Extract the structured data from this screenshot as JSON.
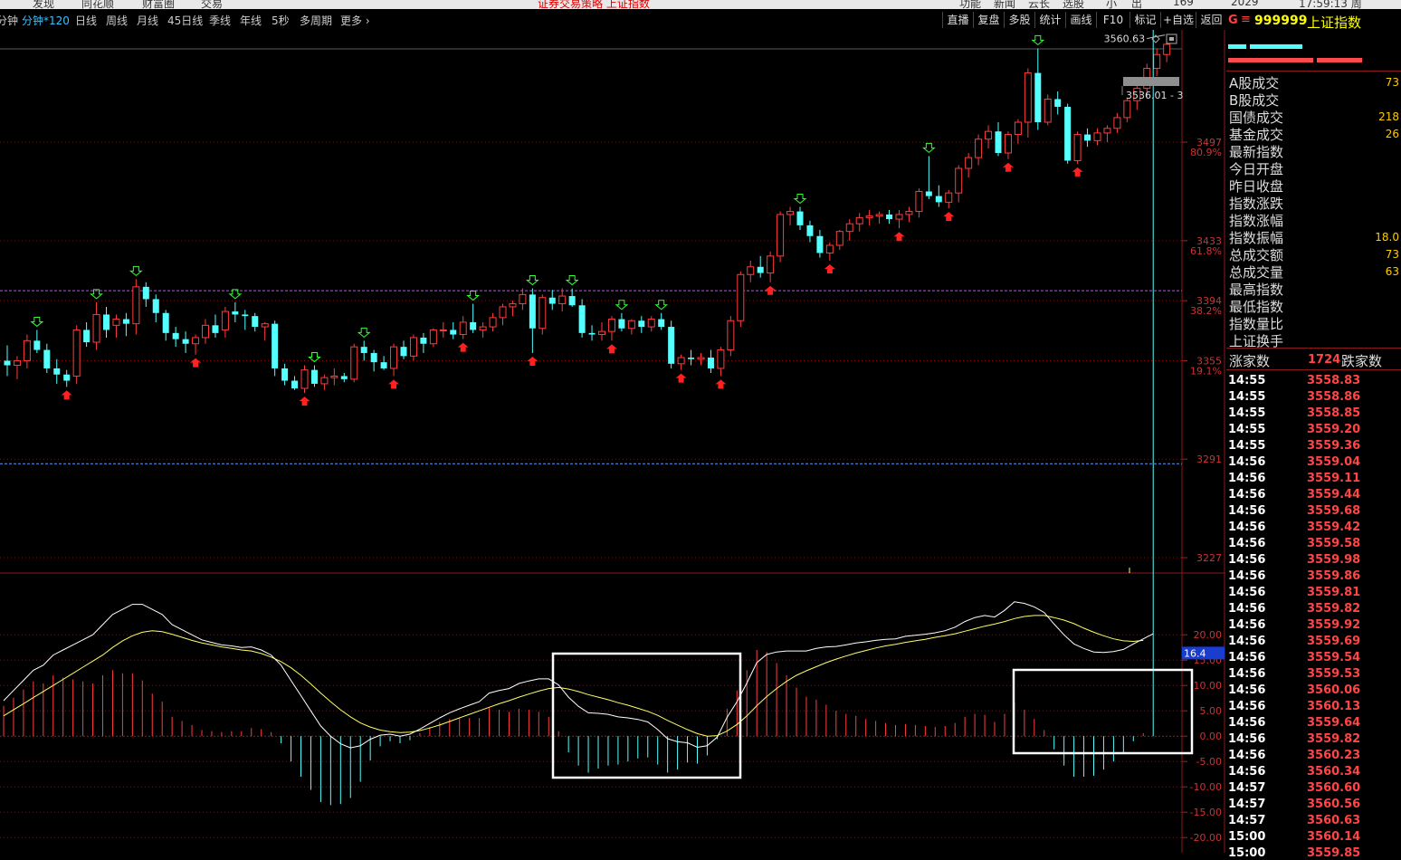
{
  "top_bar": {
    "items": [
      "发现",
      "同花顺",
      "财富圈",
      "交易"
    ],
    "center_text": "证券交易策略 上证指数",
    "right_items": [
      "功能",
      "新闻",
      "云长",
      "选股",
      "小",
      "出"
    ],
    "right_numbers": [
      "169",
      "2029"
    ],
    "clock": "17:59:13 周"
  },
  "toolbar": {
    "periods": [
      "分钟",
      "分钟*120",
      "日线",
      "周线",
      "月线",
      "45日线",
      "季线",
      "年线",
      "5秒",
      "多周期",
      "更多"
    ],
    "active_period": "分钟*120",
    "buttons": [
      "直播",
      "复盘",
      "多股",
      "统计",
      "画线",
      "F10",
      "标记",
      "+自选",
      "返回"
    ]
  },
  "header": {
    "flag": "G",
    "code": "999999",
    "name": "上证指数"
  },
  "stats": [
    {
      "label": "A股成交",
      "value": "73"
    },
    {
      "label": "B股成交",
      "value": ""
    },
    {
      "label": "国债成交",
      "value": "218"
    },
    {
      "label": "基金成交",
      "value": "26"
    },
    {
      "label": "最新指数",
      "value": ""
    },
    {
      "label": "今日开盘",
      "value": ""
    },
    {
      "label": "昨日收盘",
      "value": ""
    },
    {
      "label": "指数涨跌",
      "value": ""
    },
    {
      "label": "指数涨幅",
      "value": ""
    },
    {
      "label": "指数振幅",
      "value": "18.0"
    },
    {
      "label": "总成交额",
      "value": "73"
    },
    {
      "label": "总成交量",
      "value": "63"
    },
    {
      "label": "最高指数",
      "value": ""
    },
    {
      "label": "最低指数",
      "value": ""
    },
    {
      "label": "指数量比",
      "value": ""
    },
    {
      "label": "上证换手",
      "value": ""
    }
  ],
  "breadth": {
    "up_label": "涨家数",
    "up_count": "1724",
    "down_label": "跌家数"
  },
  "ticks": [
    {
      "time": "14:55",
      "price": "3558.83"
    },
    {
      "time": "14:55",
      "price": "3558.86"
    },
    {
      "time": "14:55",
      "price": "3558.85"
    },
    {
      "time": "14:55",
      "price": "3559.20"
    },
    {
      "time": "14:55",
      "price": "3559.36"
    },
    {
      "time": "14:56",
      "price": "3559.04"
    },
    {
      "time": "14:56",
      "price": "3559.11"
    },
    {
      "time": "14:56",
      "price": "3559.44"
    },
    {
      "time": "14:56",
      "price": "3559.68"
    },
    {
      "time": "14:56",
      "price": "3559.42"
    },
    {
      "time": "14:56",
      "price": "3559.58"
    },
    {
      "time": "14:56",
      "price": "3559.98"
    },
    {
      "time": "14:56",
      "price": "3559.86"
    },
    {
      "time": "14:56",
      "price": "3559.81"
    },
    {
      "time": "14:56",
      "price": "3559.82"
    },
    {
      "time": "14:56",
      "price": "3559.92"
    },
    {
      "time": "14:56",
      "price": "3559.69"
    },
    {
      "time": "14:56",
      "price": "3559.54"
    },
    {
      "time": "14:56",
      "price": "3559.53"
    },
    {
      "time": "14:56",
      "price": "3560.06"
    },
    {
      "time": "14:56",
      "price": "3560.13"
    },
    {
      "time": "14:56",
      "price": "3559.64"
    },
    {
      "time": "14:56",
      "price": "3559.82"
    },
    {
      "time": "14:56",
      "price": "3560.23"
    },
    {
      "time": "14:56",
      "price": "3560.34"
    },
    {
      "time": "14:57",
      "price": "3560.60"
    },
    {
      "time": "14:57",
      "price": "3560.56"
    },
    {
      "time": "14:57",
      "price": "3560.63"
    },
    {
      "time": "15:00",
      "price": "3560.14"
    },
    {
      "time": "15:00",
      "price": "3559.85"
    }
  ],
  "colors": {
    "up": "#ff3c3c",
    "down": "#54ffff",
    "dif": "#ffffff",
    "dea": "#ffff66",
    "grid": "#7a1212",
    "text": "#dddddd"
  },
  "chart_data": [
    {
      "type": "candlestick",
      "y_ticks": [
        3497,
        3433,
        3394,
        3355,
        3291,
        3227
      ],
      "y_pct_labels": [
        "80.9%",
        "61.8%",
        "38.2%",
        "19.1%"
      ],
      "ylim": [
        3217,
        3570
      ],
      "last_price_label": "3560.63",
      "prev_price_label": "3536.01 - 3",
      "pink_line": 3394,
      "blue_line": 3291,
      "candles": [
        [
          3355,
          3365,
          3345,
          3352
        ],
        [
          3352,
          3358,
          3343,
          3355
        ],
        [
          3355,
          3372,
          3350,
          3368
        ],
        [
          3368,
          3375,
          3360,
          3362
        ],
        [
          3362,
          3366,
          3347,
          3350
        ],
        [
          3350,
          3356,
          3340,
          3346
        ],
        [
          3346,
          3349,
          3338,
          3342
        ],
        [
          3345,
          3378,
          3340,
          3375
        ],
        [
          3375,
          3380,
          3364,
          3367
        ],
        [
          3367,
          3393,
          3362,
          3385
        ],
        [
          3385,
          3390,
          3370,
          3375
        ],
        [
          3378,
          3385,
          3370,
          3382
        ],
        [
          3382,
          3386,
          3371,
          3379
        ],
        [
          3379,
          3408,
          3372,
          3403
        ],
        [
          3403,
          3406,
          3390,
          3395
        ],
        [
          3395,
          3398,
          3380,
          3386
        ],
        [
          3386,
          3388,
          3368,
          3373
        ],
        [
          3373,
          3377,
          3364,
          3369
        ],
        [
          3369,
          3374,
          3360,
          3366
        ],
        [
          3366,
          3372,
          3359,
          3370
        ],
        [
          3370,
          3382,
          3366,
          3378
        ],
        [
          3378,
          3385,
          3370,
          3373
        ],
        [
          3375,
          3390,
          3370,
          3387
        ],
        [
          3387,
          3393,
          3380,
          3385
        ],
        [
          3385,
          3388,
          3375,
          3384
        ],
        [
          3384,
          3386,
          3374,
          3377
        ],
        [
          3377,
          3380,
          3368,
          3379
        ],
        [
          3379,
          3381,
          3345,
          3350
        ],
        [
          3350,
          3353,
          3339,
          3342
        ],
        [
          3342,
          3345,
          3336,
          3337
        ],
        [
          3337,
          3352,
          3334,
          3349
        ],
        [
          3349,
          3352,
          3338,
          3340
        ],
        [
          3340,
          3346,
          3336,
          3344
        ],
        [
          3344,
          3350,
          3339,
          3345
        ],
        [
          3345,
          3347,
          3341,
          3343
        ],
        [
          3343,
          3366,
          3341,
          3364
        ],
        [
          3364,
          3368,
          3355,
          3360
        ],
        [
          3360,
          3362,
          3348,
          3354
        ],
        [
          3354,
          3358,
          3349,
          3350
        ],
        [
          3350,
          3366,
          3345,
          3364
        ],
        [
          3364,
          3368,
          3356,
          3358
        ],
        [
          3358,
          3372,
          3355,
          3370
        ],
        [
          3370,
          3373,
          3360,
          3366
        ],
        [
          3366,
          3376,
          3364,
          3375
        ],
        [
          3375,
          3380,
          3370,
          3375
        ],
        [
          3375,
          3380,
          3369,
          3372
        ],
        [
          3372,
          3384,
          3369,
          3380
        ],
        [
          3380,
          3392,
          3373,
          3375
        ],
        [
          3375,
          3380,
          3370,
          3377
        ],
        [
          3377,
          3386,
          3374,
          3383
        ],
        [
          3383,
          3392,
          3378,
          3390
        ],
        [
          3390,
          3394,
          3384,
          3392
        ],
        [
          3392,
          3402,
          3388,
          3398
        ],
        [
          3398,
          3402,
          3360,
          3376
        ],
        [
          3376,
          3398,
          3372,
          3396
        ],
        [
          3396,
          3401,
          3388,
          3392
        ],
        [
          3392,
          3402,
          3387,
          3397
        ],
        [
          3397,
          3402,
          3390,
          3391
        ],
        [
          3391,
          3395,
          3370,
          3373
        ],
        [
          3373,
          3378,
          3368,
          3372
        ],
        [
          3372,
          3380,
          3368,
          3374
        ],
        [
          3374,
          3384,
          3368,
          3382
        ],
        [
          3382,
          3386,
          3374,
          3376
        ],
        [
          3376,
          3382,
          3372,
          3381
        ],
        [
          3381,
          3384,
          3373,
          3377
        ],
        [
          3377,
          3384,
          3374,
          3382
        ],
        [
          3382,
          3386,
          3375,
          3377
        ],
        [
          3377,
          3381,
          3350,
          3353
        ],
        [
          3353,
          3359,
          3349,
          3357
        ],
        [
          3357,
          3362,
          3352,
          3356
        ],
        [
          3356,
          3360,
          3352,
          3357
        ],
        [
          3357,
          3362,
          3347,
          3350
        ],
        [
          3350,
          3364,
          3345,
          3362
        ],
        [
          3362,
          3384,
          3358,
          3381
        ],
        [
          3381,
          3413,
          3377,
          3411
        ],
        [
          3411,
          3420,
          3406,
          3416
        ],
        [
          3416,
          3423,
          3409,
          3412
        ],
        [
          3412,
          3426,
          3406,
          3423
        ],
        [
          3423,
          3452,
          3419,
          3450
        ],
        [
          3450,
          3455,
          3443,
          3452
        ],
        [
          3452,
          3455,
          3440,
          3443
        ],
        [
          3443,
          3446,
          3432,
          3436
        ],
        [
          3436,
          3440,
          3422,
          3425
        ],
        [
          3425,
          3432,
          3420,
          3430
        ],
        [
          3430,
          3440,
          3427,
          3439
        ],
        [
          3439,
          3447,
          3433,
          3444
        ],
        [
          3444,
          3451,
          3439,
          3448
        ],
        [
          3448,
          3453,
          3443,
          3449
        ],
        [
          3449,
          3452,
          3444,
          3450
        ],
        [
          3450,
          3453,
          3444,
          3447
        ],
        [
          3447,
          3453,
          3441,
          3450
        ],
        [
          3450,
          3455,
          3445,
          3452
        ],
        [
          3452,
          3467,
          3448,
          3465
        ],
        [
          3465,
          3488,
          3460,
          3462
        ],
        [
          3462,
          3469,
          3455,
          3458
        ],
        [
          3458,
          3466,
          3454,
          3464
        ],
        [
          3464,
          3482,
          3458,
          3480
        ],
        [
          3480,
          3490,
          3474,
          3487
        ],
        [
          3487,
          3502,
          3482,
          3499
        ],
        [
          3499,
          3508,
          3493,
          3504
        ],
        [
          3504,
          3510,
          3488,
          3490
        ],
        [
          3490,
          3504,
          3486,
          3502
        ],
        [
          3502,
          3512,
          3496,
          3510
        ],
        [
          3510,
          3545,
          3500,
          3542
        ],
        [
          3542,
          3558,
          3505,
          3510
        ],
        [
          3510,
          3528,
          3508,
          3525
        ],
        [
          3525,
          3530,
          3515,
          3520
        ],
        [
          3520,
          3522,
          3483,
          3485
        ],
        [
          3485,
          3504,
          3483,
          3502
        ],
        [
          3502,
          3506,
          3494,
          3498
        ],
        [
          3498,
          3506,
          3495,
          3503
        ],
        [
          3503,
          3508,
          3497,
          3506
        ],
        [
          3506,
          3516,
          3503,
          3513
        ],
        [
          3513,
          3526,
          3510,
          3524
        ],
        [
          3524,
          3536,
          3518,
          3532
        ],
        [
          3532,
          3548,
          3526,
          3545
        ],
        [
          3545,
          3558,
          3540,
          3554
        ],
        [
          3554,
          3562,
          3549,
          3560.63
        ]
      ]
    },
    {
      "type": "macd",
      "y_ticks": [
        20.0,
        15.0,
        10.0,
        5.0,
        0.0,
        -5.0,
        -10.0,
        -15.0,
        -20.0
      ],
      "ylim": [
        -23,
        32
      ],
      "current_value": "16.4",
      "dif": [
        7,
        9,
        11,
        13,
        14,
        16,
        17,
        18,
        19,
        20,
        22,
        24,
        25,
        26,
        26,
        25,
        24,
        22,
        21,
        20,
        19,
        18.5,
        18,
        17.8,
        17.5,
        17.6,
        17,
        16,
        14,
        11,
        8,
        5,
        2,
        0,
        -1.5,
        -2.3,
        -1.9,
        -0.6,
        0.2,
        0.4,
        0,
        0.4,
        1.4,
        2.5,
        3.6,
        4.6,
        5.4,
        6.1,
        6.8,
        8.5,
        9,
        9.4,
        10.4,
        10.9,
        11.3,
        11.3,
        10.1,
        7.7,
        5.9,
        4.6,
        4.5,
        4.3,
        3.8,
        3.6,
        3.3,
        2.8,
        1.3,
        -0.5,
        -1.1,
        -1.3,
        -2.2,
        -1.9,
        -0.2,
        3.7,
        6.8,
        10.5,
        14.5,
        16.1,
        16.6,
        16.8,
        16.8,
        16.8,
        17.3,
        17.6,
        17.7,
        18,
        18.4,
        18.6,
        18.9,
        19.1,
        19.2,
        19.7,
        19.9,
        20.1,
        20.4,
        20.8,
        21.5,
        22.6,
        23.4,
        23.8,
        23.5,
        24.8,
        26.5,
        26.2,
        25.5,
        24.4,
        22.1,
        20,
        18.2,
        17.3,
        16.6,
        16.5,
        16.7,
        17.1,
        18.2,
        19.2,
        20.2
      ],
      "dea": [
        4,
        5.2,
        6.4,
        7.6,
        8.8,
        10,
        11.2,
        12.4,
        13.6,
        14.8,
        16,
        17.5,
        18.8,
        19.8,
        20.5,
        20.8,
        20.6,
        20.1,
        19.5,
        18.9,
        18.4,
        18,
        17.6,
        17.3,
        17,
        16.8,
        16.3,
        15.6,
        14.7,
        13.5,
        12,
        10.3,
        8.5,
        6.8,
        5.2,
        3.8,
        2.6,
        1.8,
        1.2,
        0.9,
        0.7,
        0.8,
        1.1,
        1.6,
        2.2,
        2.9,
        3.6,
        4.3,
        5,
        5.7,
        6.4,
        7,
        7.7,
        8.3,
        8.9,
        9.4,
        9.6,
        9.3,
        8.8,
        8.2,
        7.7,
        7.2,
        6.6,
        6.1,
        5.5,
        4.9,
        4.1,
        3.1,
        2.2,
        1.3,
        0.5,
        0,
        0.1,
        1,
        2.3,
        4,
        6,
        7.8,
        9.4,
        10.8,
        12,
        12.9,
        13.7,
        14.5,
        15.2,
        15.8,
        16.4,
        16.9,
        17.4,
        17.8,
        18.1,
        18.5,
        18.8,
        19.1,
        19.5,
        19.8,
        20.2,
        20.7,
        21.2,
        21.7,
        22.1,
        22.6,
        23.2,
        23.6,
        23.8,
        23.8,
        23.4,
        22.9,
        22.2,
        21.3,
        20.5,
        19.8,
        19.2,
        18.8,
        18.7,
        18.9
      ]
    }
  ]
}
